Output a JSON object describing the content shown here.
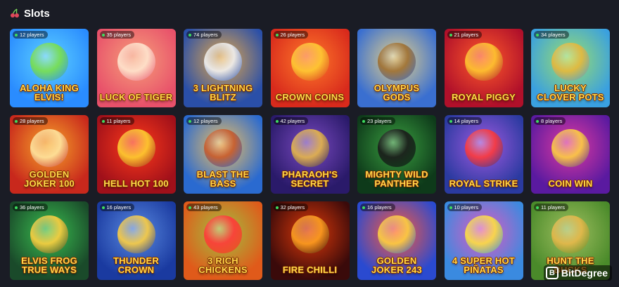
{
  "header": {
    "title": "Slots",
    "icon": "cherries-icon"
  },
  "games": [
    {
      "players": "12 players",
      "name": "Aloha King Elvis!",
      "colors": [
        "#2a8cff",
        "#5ed2ff"
      ],
      "accent": "#7be04a"
    },
    {
      "players": "35 players",
      "name": "Luck of Tiger",
      "colors": [
        "#e8516a",
        "#f6a07a"
      ],
      "accent": "#ffe7d0"
    },
    {
      "players": "74 players",
      "name": "3 Lightning Blitz",
      "colors": [
        "#2a4fa8",
        "#e5a94a"
      ],
      "accent": "#f2f2f2"
    },
    {
      "players": "26 players",
      "name": "Crown Coins",
      "colors": [
        "#d82a1c",
        "#ff7a2a"
      ],
      "accent": "#ffcc33"
    },
    {
      "players": "",
      "name": "Olympus Gods",
      "colors": [
        "#3a6fd0",
        "#e6d28a"
      ],
      "accent": "#a07030"
    },
    {
      "players": "21 players",
      "name": "Royal Piggy",
      "colors": [
        "#b0102a",
        "#ff5a2a"
      ],
      "accent": "#ffc830"
    },
    {
      "players": "34 players",
      "name": "Lucky Clover Pots",
      "colors": [
        "#3aa0e0",
        "#9de06a"
      ],
      "accent": "#e8b83a"
    },
    {
      "players": "28 players",
      "name": "Golden Joker 100",
      "colors": [
        "#c8281c",
        "#f7a52a"
      ],
      "accent": "#ffe6a0"
    },
    {
      "players": "11 players",
      "name": "Hell Hot 100",
      "colors": [
        "#a0101a",
        "#ff3a1a"
      ],
      "accent": "#ffd030"
    },
    {
      "players": "12 players",
      "name": "Blast the Bass",
      "colors": [
        "#2a6ad0",
        "#f0c060"
      ],
      "accent": "#c85a2a"
    },
    {
      "players": "42 players",
      "name": "Pharaoh's Secret",
      "colors": [
        "#2a1a6a",
        "#7a4ac0"
      ],
      "accent": "#e8b84a"
    },
    {
      "players": "23 players",
      "name": "Mighty Wild Panther",
      "colors": [
        "#0e3a1a",
        "#3aa040"
      ],
      "accent": "#1a1a1a"
    },
    {
      "players": "14 players",
      "name": "Royal Strike",
      "colors": [
        "#2a3aa0",
        "#a05ae0"
      ],
      "accent": "#ff3a3a"
    },
    {
      "players": "8 players",
      "name": "Coin Win",
      "colors": [
        "#5a1aa0",
        "#e03aa0"
      ],
      "accent": "#ffd040"
    },
    {
      "players": "36 players",
      "name": "Elvis Frog True Ways",
      "colors": [
        "#1a4a2a",
        "#3ac050"
      ],
      "accent": "#ffd040"
    },
    {
      "players": "16 players",
      "name": "Thunder Crown",
      "colors": [
        "#1a3aa0",
        "#5a8ae0"
      ],
      "accent": "#ffd040"
    },
    {
      "players": "43 players",
      "name": "3 Rich Chickens",
      "colors": [
        "#e05a1a",
        "#a0c040"
      ],
      "accent": "#ff3a3a"
    },
    {
      "players": "32 players",
      "name": "Fire Chilli",
      "colors": [
        "#3a0a0a",
        "#e03a0a"
      ],
      "accent": "#ffa020"
    },
    {
      "players": "16 players",
      "name": "Golden Joker 243",
      "colors": [
        "#2a4ad0",
        "#ff5a3a"
      ],
      "accent": "#ffd040"
    },
    {
      "players": "10 players",
      "name": "4 Super Hot Piñatas",
      "colors": [
        "#3a8ae0",
        "#e05ac0"
      ],
      "accent": "#ffe040"
    },
    {
      "players": "11 players",
      "name": "Hunt the Bucks",
      "colors": [
        "#4a8a2a",
        "#a0c060"
      ],
      "accent": "#e8b84a"
    }
  ],
  "watermark": {
    "label": "BitDegree",
    "icon": "bitdegree-logo-icon"
  }
}
